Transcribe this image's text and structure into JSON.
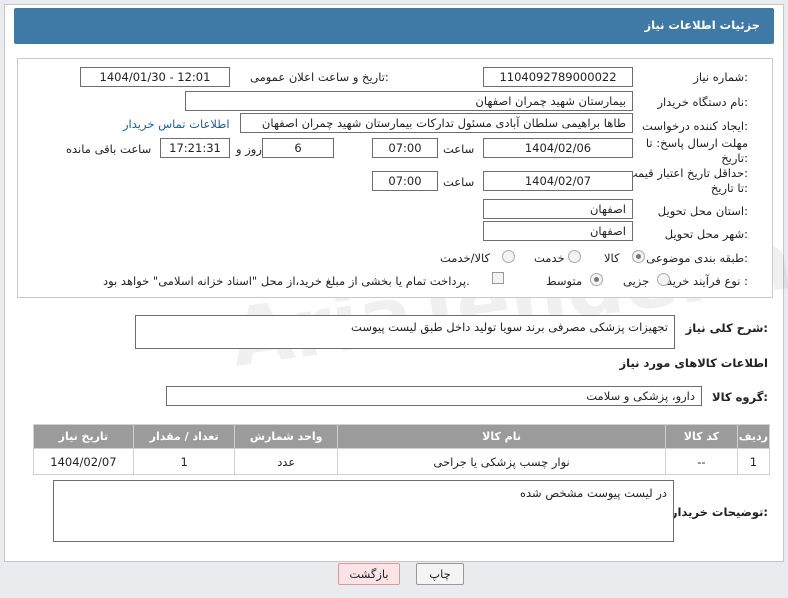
{
  "header": {
    "title": "جزئیات اطلاعات نیاز"
  },
  "form": {
    "need_number_label": "شماره نیاز:",
    "need_number": "1104092789000022",
    "announce_label": "تاریخ و ساعت اعلان عمومی:",
    "announce_value": "1404/01/30 - 12:01",
    "buyer_label": "نام دستگاه خریدار:",
    "buyer_value": "بیمارستان شهید چمران اصفهان",
    "creator_label": "ایجاد کننده درخواست:",
    "creator_value": "طاها براهیمی سلطان آبادی مسئول تدارکات  بیمارستان شهید چمران اصفهان",
    "contact_link": "اطلاعات تماس خریدار",
    "deadline_label_1": "مهلت ارسال پاسخ: تا",
    "deadline_label_2": "تاریخ:",
    "deadline_date": "1404/02/06",
    "time_label": "ساعت",
    "deadline_time": "07:00",
    "days_value": "6",
    "days_label": "روز و",
    "remaining_time": "17:21:31",
    "remaining_label": "ساعت باقی مانده",
    "price_label_1": "حداقل تاریخ اعتبار قیمت:",
    "price_label_2": "تا تاریخ:",
    "price_date": "1404/02/07",
    "price_time": "07:00",
    "province_label": "استان محل تحویل:",
    "province_value": "اصفهان",
    "city_label": "شهر محل تحویل:",
    "city_value": "اصفهان",
    "category_label": "طبقه بندی موضوعی:",
    "category_options": [
      "کالا",
      "خدمت",
      "کالا/خدمت"
    ],
    "process_label": "نوع فرآیند خرید :",
    "process_options": [
      "جزیی",
      "متوسط"
    ],
    "payment_note": "پرداخت تمام یا بخشی از مبلغ خرید،از محل \"اسناد خزانه اسلامی\" خواهد بود."
  },
  "description": {
    "label": "شرح کلی نیاز:",
    "value": "تجهیزات پزشکی مصرفی برند سویا تولید داخل طبق لیست پیوست"
  },
  "goods": {
    "section_title": "اطلاعات کالاهای مورد نیاز",
    "group_label": "گروه کالا:",
    "group_value": "دارو، پزشکی و سلامت",
    "columns": [
      "ردیف",
      "کد کالا",
      "نام کالا",
      "واحد شمارش",
      "تعداد / مقدار",
      "تاریخ نیاز"
    ],
    "rows": [
      {
        "row": "1",
        "code": "--",
        "name": "نوار چسب پزشکی یا جراحی",
        "unit": "عدد",
        "qty": "1",
        "date": "1404/02/07"
      }
    ]
  },
  "buyer_notes": {
    "label": "توضیحات خریدار:",
    "value": "در لیست پیوست مشخص شده"
  },
  "buttons": {
    "print": "چاپ",
    "back": "بازگشت"
  },
  "watermark_text": "AriaTender.net"
}
